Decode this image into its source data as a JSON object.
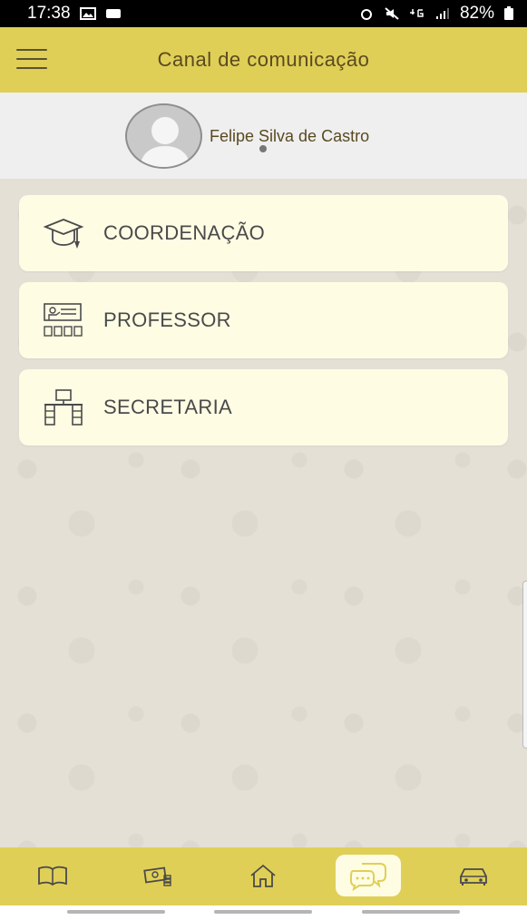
{
  "status_bar": {
    "time": "17:38",
    "battery": "82%",
    "icons_left": [
      "image-icon",
      "media-icon"
    ],
    "icons_right": [
      "alarm-icon",
      "mute-icon",
      "4g-icon",
      "signal-icon",
      "battery-icon"
    ]
  },
  "header": {
    "title": "Canal de comunicação",
    "menu_icon": "hamburger-icon"
  },
  "profile": {
    "name": "Felipe Silva de Castro"
  },
  "menu": [
    {
      "label": "COORDENAÇÃO",
      "icon": "graduation-cap-icon"
    },
    {
      "label": "PROFESSOR",
      "icon": "teacher-icon"
    },
    {
      "label": "SECRETARIA",
      "icon": "desk-icon"
    }
  ],
  "bottom_nav": [
    {
      "icon": "book-icon",
      "active": false
    },
    {
      "icon": "money-icon",
      "active": false
    },
    {
      "icon": "home-icon",
      "active": false
    },
    {
      "icon": "chat-icon",
      "active": true
    },
    {
      "icon": "car-icon",
      "active": false
    }
  ],
  "colors": {
    "accent": "#e0cf57",
    "card_background": "#fefde4",
    "text_brown": "#5a4a20"
  }
}
